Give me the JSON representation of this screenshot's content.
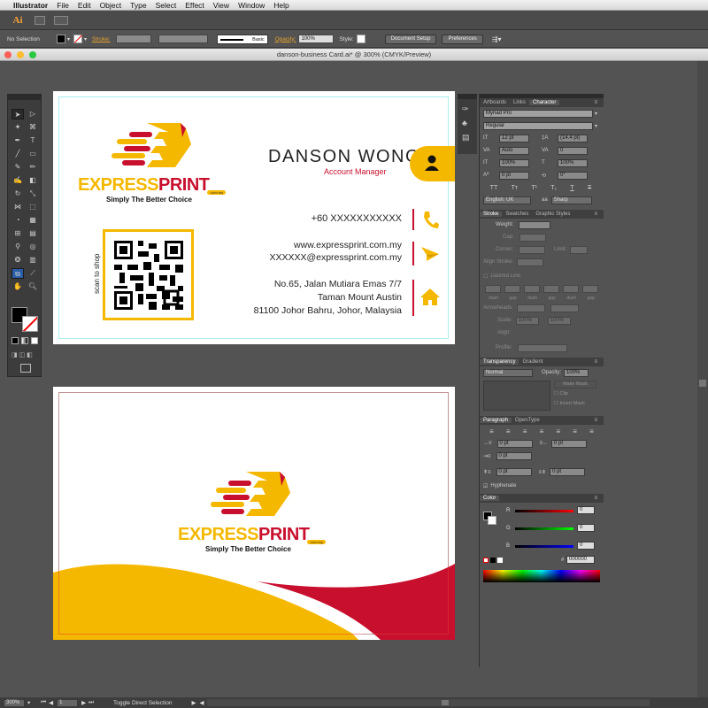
{
  "menubar": {
    "app": "Illustrator",
    "items": [
      "File",
      "Edit",
      "Object",
      "Type",
      "Select",
      "Effect",
      "View",
      "Window",
      "Help"
    ]
  },
  "approw": {
    "logo": "Ai"
  },
  "control": {
    "selection": "No Selection",
    "stroke_label": "Stroke:",
    "stroke_style": "Basic",
    "opacity_label": "Opacity:",
    "opacity_value": "100%",
    "style_label": "Style:",
    "doc_setup": "Document Setup",
    "preferences": "Preferences"
  },
  "document": {
    "title": "danson-business Card.ai* @ 300% (CMYK/Preview)"
  },
  "card_front": {
    "brand_main": "EXPRESS",
    "brand_accent": "PRINT",
    "brand_suffix": ".com.my",
    "tagline": "Simply The Better Choice",
    "name": "DANSON WONG",
    "role": "Account Manager",
    "phone": "+60 XXXXXXXXXXX",
    "website": "www.expressprint.com.my",
    "email": "XXXXXX@expressprint.com.my",
    "address_line1": "No.65, Jalan Mutiara Emas 7/7",
    "address_line2": "Taman Mount Austin",
    "address_line3": "81100 Johor Bahru, Johor, Malaysia",
    "qr_caption": "scan to shop"
  },
  "card_back": {
    "brand_main": "EXPRESS",
    "brand_accent": "PRINT",
    "brand_suffix": ".com.my",
    "tagline": "Simply The Better Choice"
  },
  "colors": {
    "brand_yellow": "#f5b800",
    "brand_red": "#c8102e",
    "ui_dark": "#535353"
  },
  "panels": {
    "character_tabs": [
      "Artboards",
      "Links",
      "Character"
    ],
    "font": "Myriad Pro",
    "font_style": "Regular",
    "font_size": "12 pt",
    "leading": "(14.4 pt)",
    "kerning": "Auto",
    "tracking": "0",
    "vscale": "100%",
    "hscale": "100%",
    "baseline": "0 pt",
    "rotation": "0°",
    "language": "English: UK",
    "antialias": "Sharp",
    "stroke_tabs": [
      "Stroke",
      "Swatches",
      "Graphic Styles"
    ],
    "weight_label": "Weight:",
    "cap_label": "Cap:",
    "corner_label": "Corner:",
    "limit_label": "Limit:",
    "align_label": "Align Stroke:",
    "dashed_line": "Dashed Line",
    "dash_labels": [
      "dash",
      "gap",
      "dash",
      "gap",
      "dash",
      "gap"
    ],
    "arrowheads": "Arrowheads:",
    "scale": "Scale:",
    "scale_v1": "100%",
    "scale_v2": "100%",
    "align": "Align:",
    "profile": "Profile:",
    "transparency_tabs": [
      "Transparency",
      "Gradient"
    ],
    "blend": "Normal",
    "opacity_label": "Opacity:",
    "opacity": "100%",
    "make_mask": "Make Mask",
    "clip": "Clip",
    "invert_mask": "Invert Mask",
    "paragraph_tabs": [
      "Paragraph",
      "OpenType"
    ],
    "indent_left": "0 pt",
    "indent_right": "0 pt",
    "indent_first": "0 pt",
    "space_before": "0 pt",
    "space_after": "0 pt",
    "hyphenate": "Hyphenate",
    "color_tab": "Color",
    "r": "0",
    "g": "0",
    "b": "0",
    "hex": "000000"
  },
  "status": {
    "zoom": "300%",
    "page": "1",
    "tool": "Toggle Direct Selection"
  }
}
